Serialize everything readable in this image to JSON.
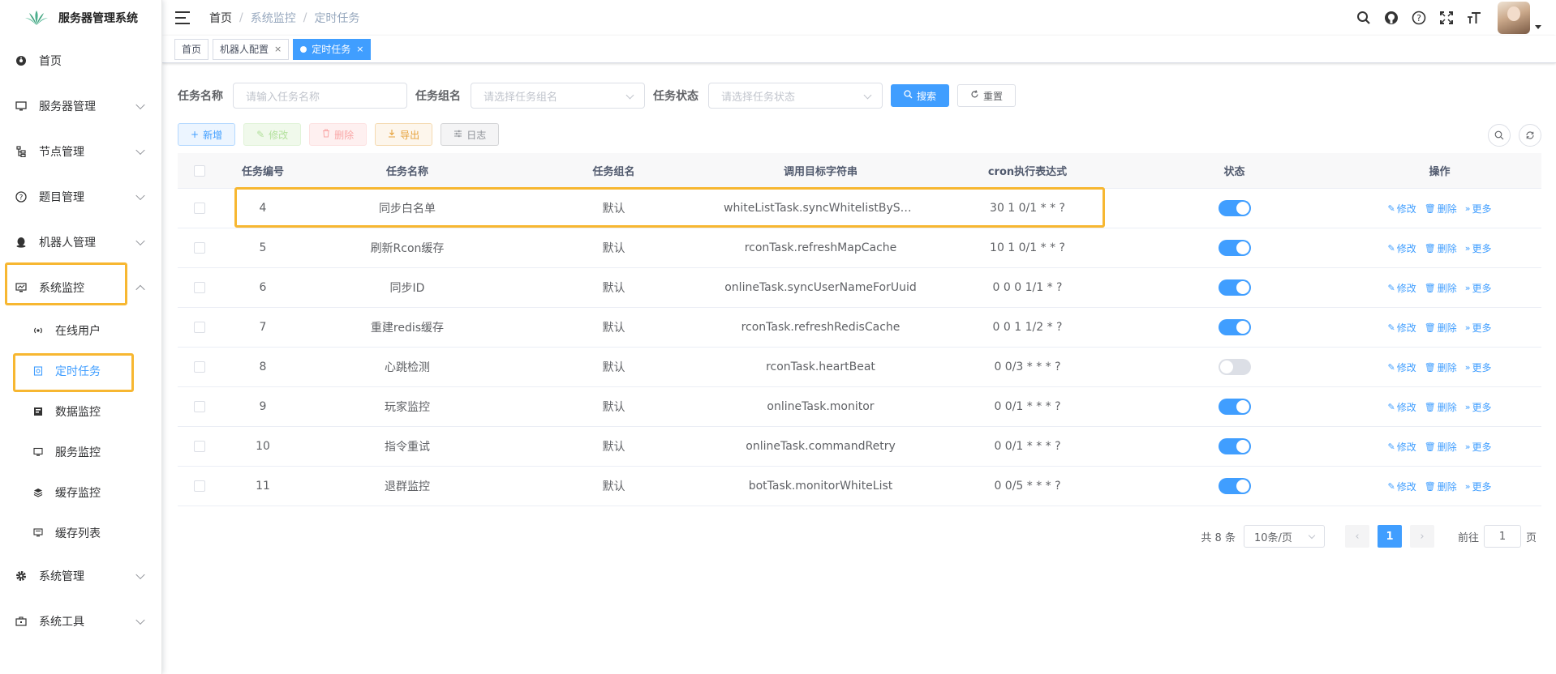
{
  "app": {
    "title": "服务器管理系统"
  },
  "sidebar": {
    "items": [
      {
        "label": "首页",
        "icon": "dashboard-icon"
      },
      {
        "label": "服务器管理",
        "icon": "monitor-icon"
      },
      {
        "label": "节点管理",
        "icon": "tree-icon"
      },
      {
        "label": "题目管理",
        "icon": "question-icon"
      },
      {
        "label": "机器人管理",
        "icon": "qq-icon"
      },
      {
        "label": "系统监控",
        "icon": "monitor-chart-icon",
        "expanded": true
      },
      {
        "label": "系统管理",
        "icon": "gear-icon"
      },
      {
        "label": "系统工具",
        "icon": "toolbox-icon"
      }
    ],
    "sub_items": [
      {
        "label": "在线用户",
        "icon": "online-icon"
      },
      {
        "label": "定时任务",
        "icon": "job-icon",
        "active": true
      },
      {
        "label": "数据监控",
        "icon": "data-icon"
      },
      {
        "label": "服务监控",
        "icon": "server-icon"
      },
      {
        "label": "缓存监控",
        "icon": "redis-icon"
      },
      {
        "label": "缓存列表",
        "icon": "redis-list-icon"
      }
    ]
  },
  "breadcrumb": {
    "home": "首页",
    "sep": "/",
    "parent": "系统监控",
    "current": "定时任务"
  },
  "tags": [
    {
      "label": "首页"
    },
    {
      "label": "机器人配置",
      "close": "×"
    },
    {
      "label": "定时任务",
      "close": "×",
      "active": true
    }
  ],
  "search": {
    "job_name_label": "任务名称",
    "job_name_placeholder": "请输入任务名称",
    "job_group_label": "任务组名",
    "job_group_placeholder": "请选择任务组名",
    "status_label": "任务状态",
    "status_placeholder": "请选择任务状态",
    "search_btn": "搜索",
    "reset_btn": "重置"
  },
  "toolbar": {
    "add": "新增",
    "edit": "修改",
    "delete": "删除",
    "export": "导出",
    "log": "日志"
  },
  "table": {
    "headers": [
      "任务编号",
      "任务名称",
      "任务组名",
      "调用目标字符串",
      "cron执行表达式",
      "状态",
      "操作"
    ],
    "ops": {
      "edit": "修改",
      "delete": "删除",
      "more": "更多"
    },
    "rows": [
      {
        "id": "4",
        "name": "同步白名单",
        "group": "默认",
        "target": "whiteListTask.syncWhitelistByServ...",
        "cron": "30 1 0/1 * * ?",
        "enabled": true
      },
      {
        "id": "5",
        "name": "刷新Rcon缓存",
        "group": "默认",
        "target": "rconTask.refreshMapCache",
        "cron": "10 1 0/1 * * ?",
        "enabled": true
      },
      {
        "id": "6",
        "name": "同步ID",
        "group": "默认",
        "target": "onlineTask.syncUserNameForUuid",
        "cron": "0 0 0 1/1 * ?",
        "enabled": true
      },
      {
        "id": "7",
        "name": "重建redis缓存",
        "group": "默认",
        "target": "rconTask.refreshRedisCache",
        "cron": "0 0 1 1/2 * ?",
        "enabled": true
      },
      {
        "id": "8",
        "name": "心跳检测",
        "group": "默认",
        "target": "rconTask.heartBeat",
        "cron": "0 0/3 * * * ?",
        "enabled": false
      },
      {
        "id": "9",
        "name": "玩家监控",
        "group": "默认",
        "target": "onlineTask.monitor",
        "cron": "0 0/1 * * * ?",
        "enabled": true
      },
      {
        "id": "10",
        "name": "指令重试",
        "group": "默认",
        "target": "onlineTask.commandRetry",
        "cron": "0 0/1 * * * ?",
        "enabled": true
      },
      {
        "id": "11",
        "name": "退群监控",
        "group": "默认",
        "target": "botTask.monitorWhiteList",
        "cron": "0 0/5 * * * ?",
        "enabled": true
      }
    ]
  },
  "pagination": {
    "total": "共 8 条",
    "page_size": "10条/页",
    "prev": "‹",
    "current": "1",
    "next": "›",
    "goto_label": "前往",
    "goto_value": "1",
    "page_unit": "页"
  },
  "colors": {
    "primary": "#409eff",
    "highlight": "#f7b731"
  }
}
